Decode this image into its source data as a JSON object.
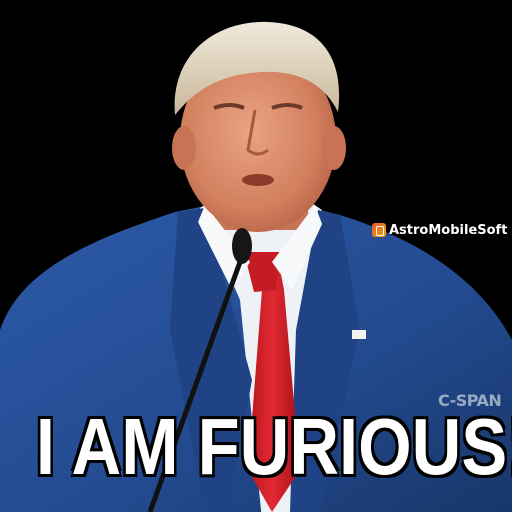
{
  "caption": "I AM FURIOUS!!",
  "watermark": "AstroMobileSoft",
  "network_bug": "C-SPAN",
  "colors": {
    "background": "#000000",
    "suit": "#234a8f",
    "tie": "#d41f2a",
    "shirt": "#eef1f5",
    "skin": "#d88a66",
    "hair": "#e2d8c4",
    "caption_text": "#ffffff"
  }
}
